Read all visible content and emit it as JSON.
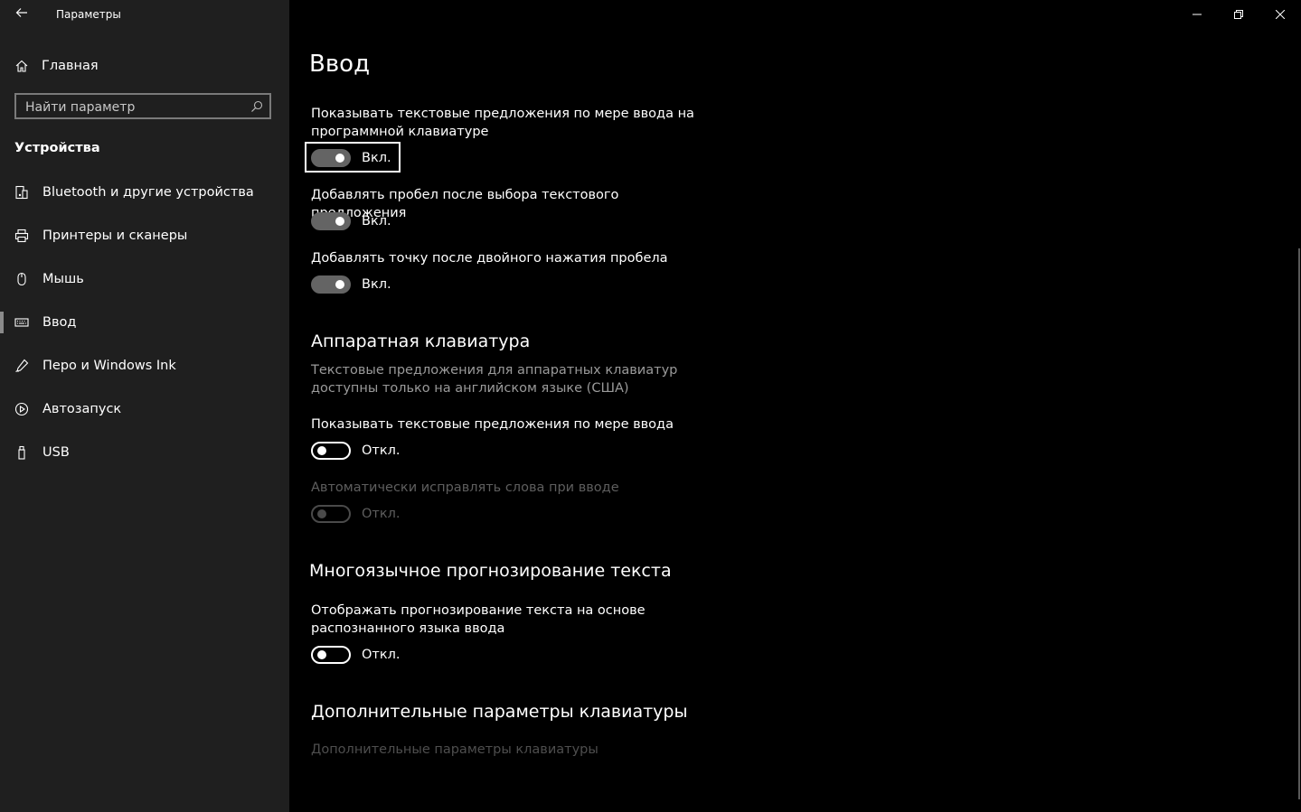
{
  "window": {
    "title": "Параметры"
  },
  "sidebar": {
    "home_label": "Главная",
    "search_placeholder": "Найти параметр",
    "section_title": "Устройства",
    "items": [
      {
        "label": "Bluetooth и другие устройства",
        "icon": "bluetooth-devices-icon"
      },
      {
        "label": "Принтеры и сканеры",
        "icon": "printer-icon"
      },
      {
        "label": "Мышь",
        "icon": "mouse-icon"
      },
      {
        "label": "Ввод",
        "icon": "keyboard-icon",
        "active": true
      },
      {
        "label": "Перо и Windows Ink",
        "icon": "pen-icon"
      },
      {
        "label": "Автозапуск",
        "icon": "autoplay-icon"
      },
      {
        "label": "USB",
        "icon": "usb-icon"
      }
    ]
  },
  "main": {
    "title": "Ввод",
    "settings": [
      {
        "label": "Показывать текстовые предложения по мере ввода на программной клавиатуре",
        "state": "Вкл.",
        "on": true,
        "enabled": true
      },
      {
        "label": "Добавлять пробел после выбора текстового предложения",
        "state": "Вкл.",
        "on": true,
        "enabled": true
      },
      {
        "label": "Добавлять точку после двойного нажатия пробела",
        "state": "Вкл.",
        "on": true,
        "enabled": true
      }
    ],
    "hardware": {
      "heading": "Аппаратная клавиатура",
      "description": "Текстовые предложения для аппаратных клавиатур доступны только на английском языке (США)",
      "settings": [
        {
          "label": "Показывать текстовые предложения по мере ввода",
          "state": "Откл.",
          "on": false,
          "enabled": true
        },
        {
          "label": "Автоматически исправлять слова при вводе",
          "state": "Откл.",
          "on": false,
          "enabled": false
        }
      ]
    },
    "multilingual": {
      "heading": "Многоязычное прогнозирование текста",
      "settings": [
        {
          "label": "Отображать прогнозирование текста на основе распознанного языка ввода",
          "state": "Откл.",
          "on": false,
          "enabled": true
        }
      ]
    },
    "advanced": {
      "heading": "Дополнительные параметры клавиатуры",
      "link": "Дополнительные параметры клавиатуры"
    }
  },
  "colors": {
    "sidebar_bg": "#1f1f1f",
    "content_bg": "#000000",
    "toggle_on": "#646464",
    "disabled_text": "#5e5e5e"
  }
}
